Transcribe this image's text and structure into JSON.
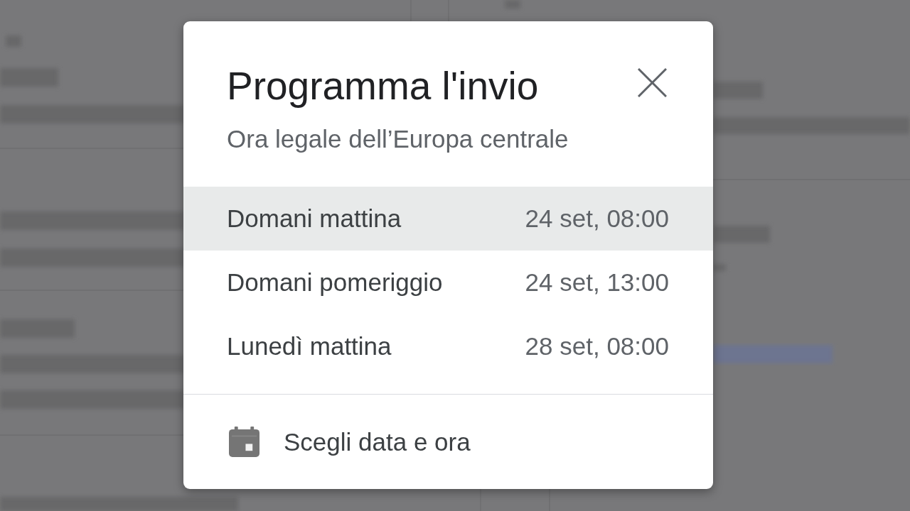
{
  "dialog": {
    "title": "Programma l'invio",
    "subtitle": "Ora legale dell’Europa centrale",
    "options": [
      {
        "label": "Domani mattina",
        "time": "24 set, 08:00",
        "selected": true
      },
      {
        "label": "Domani pomeriggio",
        "time": "24 set, 13:00",
        "selected": false
      },
      {
        "label": "Lunedì mattina",
        "time": "28 set, 08:00",
        "selected": false
      }
    ],
    "custom_option": {
      "label": "Scegli data e ora"
    }
  }
}
